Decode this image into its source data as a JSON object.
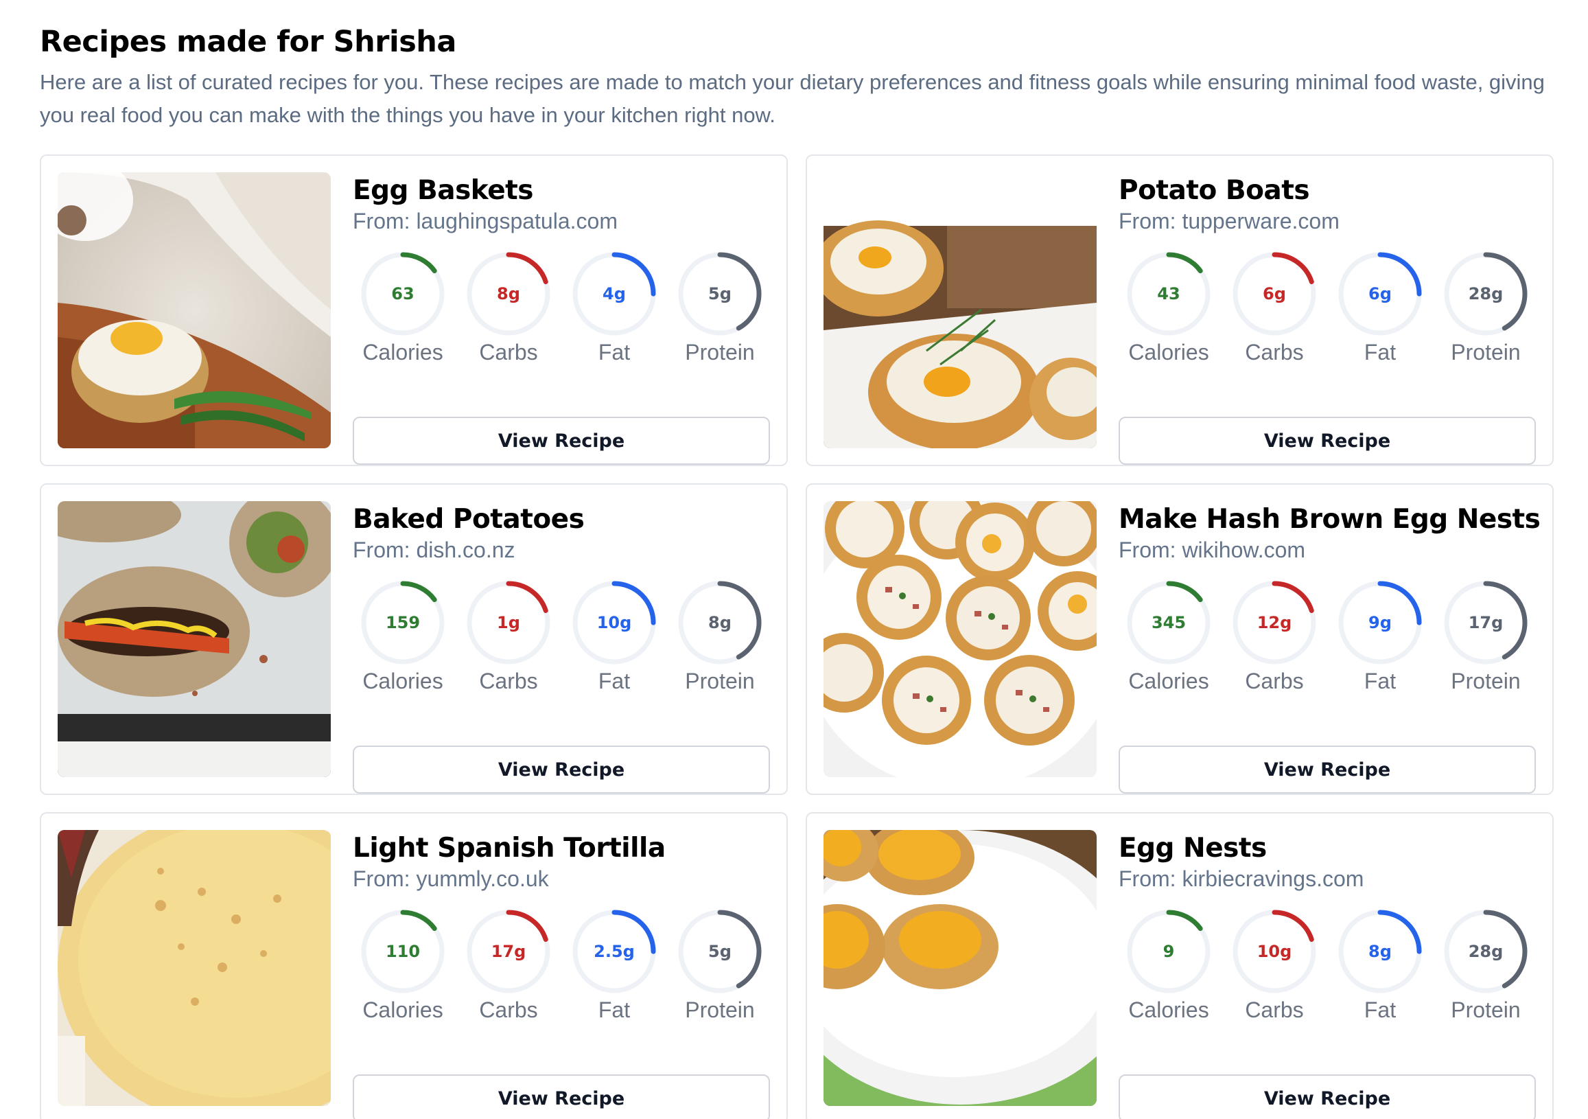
{
  "header": {
    "title": "Recipes made for Shrisha",
    "subtitle": "Here are a list of curated recipes for you. These recipes are made to match your dietary preferences and fitness goals while ensuring minimal food waste, giving you real food you can make with the things you have in your kitchen right now."
  },
  "colors": {
    "calories": "#2e7d32",
    "carbs": "#c62828",
    "fat": "#2563eb",
    "protein": "#5b6370",
    "track": "#eef1f5"
  },
  "labels": {
    "calories": "Calories",
    "carbs": "Carbs",
    "fat": "Fat",
    "protein": "Protein",
    "view_recipe": "View Recipe"
  },
  "recipes": [
    {
      "title": "Egg Baskets",
      "source": "From: laughingspatula.com",
      "image": "egg-baskets-photo",
      "calories": "63",
      "carbs": "8g",
      "fat": "4g",
      "protein": "5g",
      "fill": {
        "calories": 0.15,
        "carbs": 0.2,
        "fat": 0.25,
        "protein": 0.42
      }
    },
    {
      "title": "Potato Boats",
      "source": "From: tupperware.com",
      "image": "potato-boats-photo",
      "calories": "43",
      "carbs": "6g",
      "fat": "6g",
      "protein": "28g",
      "fill": {
        "calories": 0.15,
        "carbs": 0.2,
        "fat": 0.25,
        "protein": 0.42
      }
    },
    {
      "title": "Baked Potatoes",
      "source": "From: dish.co.nz",
      "image": "baked-potatoes-photo",
      "calories": "159",
      "carbs": "1g",
      "fat": "10g",
      "protein": "8g",
      "fill": {
        "calories": 0.15,
        "carbs": 0.2,
        "fat": 0.25,
        "protein": 0.42
      }
    },
    {
      "title": "Make Hash Brown Egg Nests",
      "source": "From: wikihow.com",
      "image": "hash-brown-egg-nests-photo",
      "calories": "345",
      "carbs": "12g",
      "fat": "9g",
      "protein": "17g",
      "fill": {
        "calories": 0.15,
        "carbs": 0.2,
        "fat": 0.25,
        "protein": 0.42
      }
    },
    {
      "title": "Light Spanish Tortilla",
      "source": "From: yummly.co.uk",
      "image": "spanish-tortilla-photo",
      "calories": "110",
      "carbs": "17g",
      "fat": "2.5g",
      "protein": "5g",
      "fill": {
        "calories": 0.15,
        "carbs": 0.2,
        "fat": 0.25,
        "protein": 0.42
      }
    },
    {
      "title": "Egg Nests",
      "source": "From: kirbiecravings.com",
      "image": "egg-nests-photo",
      "calories": "9",
      "carbs": "10g",
      "fat": "8g",
      "protein": "28g",
      "fill": {
        "calories": 0.15,
        "carbs": 0.2,
        "fat": 0.25,
        "protein": 0.42
      }
    }
  ]
}
